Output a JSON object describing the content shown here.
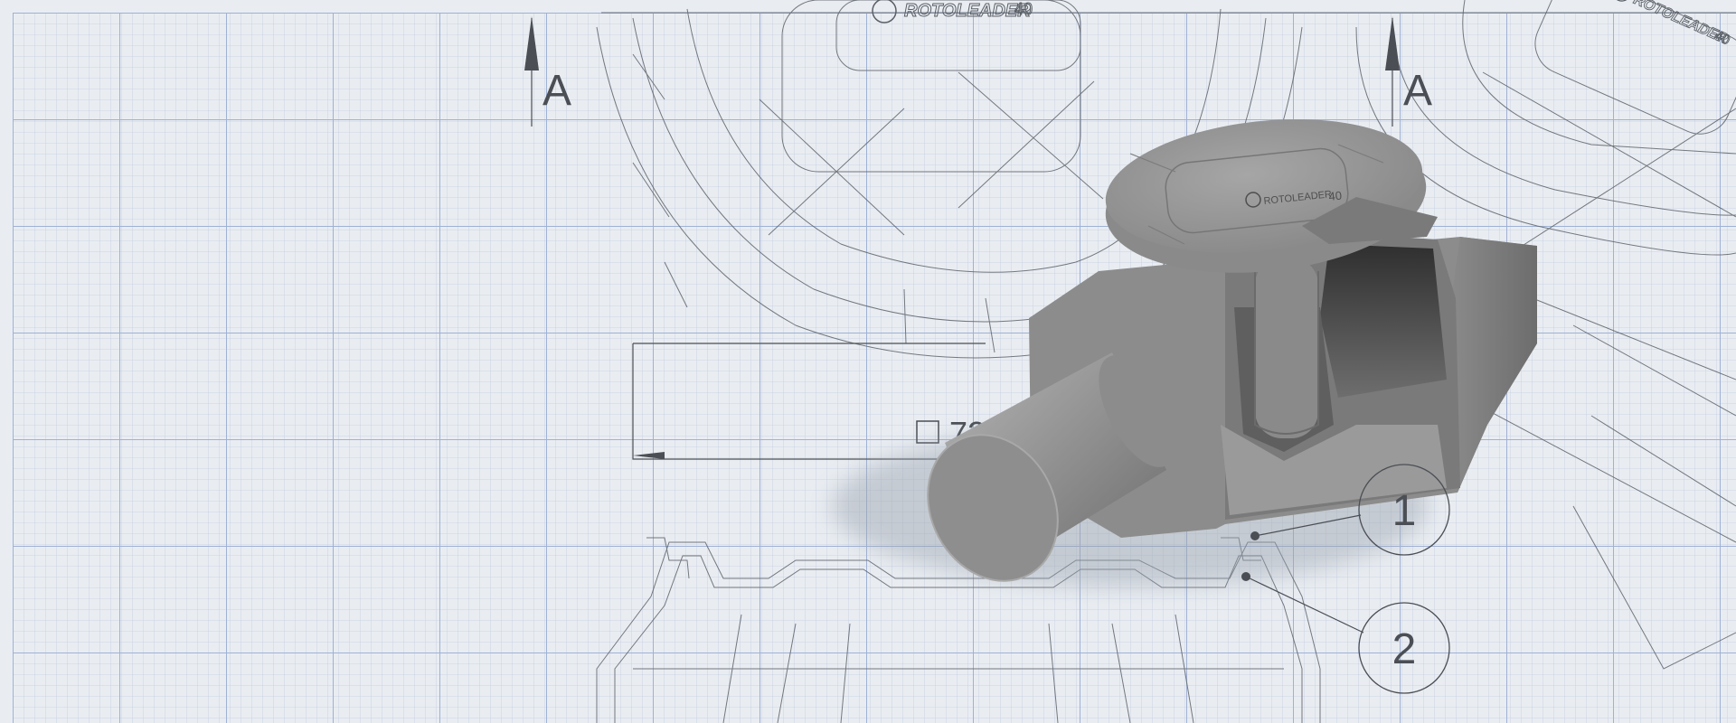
{
  "section_marker": {
    "letter": "A"
  },
  "logo": {
    "brand": "ROTOLEADER",
    "model": "40"
  },
  "dimension": {
    "symbol": "□",
    "value": "72"
  },
  "callouts": [
    "1",
    "2"
  ],
  "colors": {
    "paper": "#e9edf2",
    "grid_fine": "#bcc8dc",
    "grid_major": "#9db0d2",
    "line_art": "#5a5f66",
    "model_light": "#a9a9a9",
    "model_mid": "#8f8f8f",
    "model_dark": "#5e5e5e"
  },
  "icons": [
    "section-arrow-icon",
    "dimension-arrow-icon",
    "logo-r-icon"
  ]
}
